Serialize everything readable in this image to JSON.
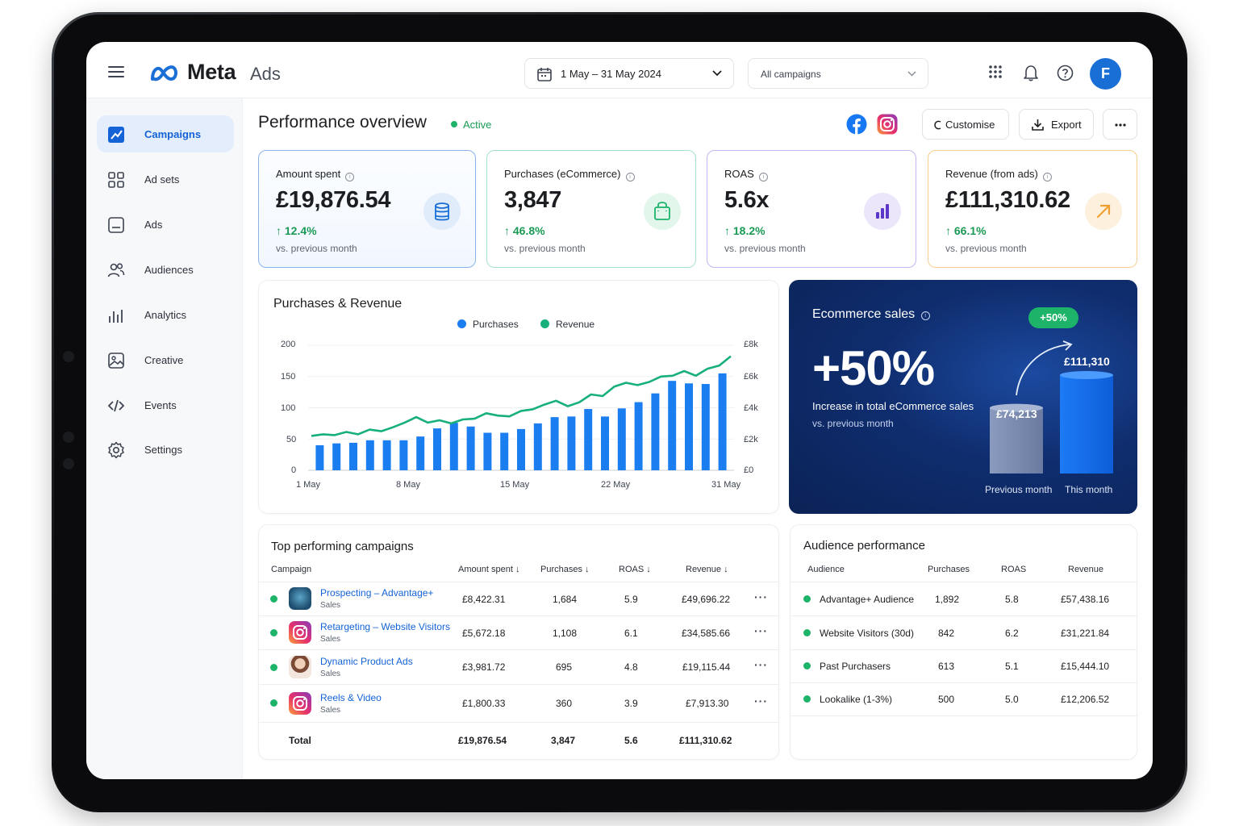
{
  "app": {
    "brand": "Meta",
    "brand_sub": "Ads"
  },
  "topbar": {
    "date_range": "1 May – 31 May 2024",
    "campaign_filter": "All campaigns",
    "avatar_initial": "F"
  },
  "sidebar": {
    "items": [
      {
        "label": "Campaigns",
        "icon": "campaigns-icon",
        "active": true
      },
      {
        "label": "Ad sets",
        "icon": "grid-icon"
      },
      {
        "label": "Ads",
        "icon": "ads-icon"
      },
      {
        "label": "Audiences",
        "icon": "people-icon"
      },
      {
        "label": "Analytics",
        "icon": "bar-chart-icon"
      },
      {
        "label": "Creative",
        "icon": "image-icon"
      },
      {
        "label": "Events",
        "icon": "code-icon"
      },
      {
        "label": "Settings",
        "icon": "gear-icon"
      }
    ]
  },
  "header": {
    "title": "Performance overview",
    "status": "Active",
    "customise_label": "Customise",
    "export_label": "Export"
  },
  "kpis": [
    {
      "label": "Amount spent",
      "value": "£19,876.54",
      "delta": "12.4%",
      "sub": "vs. previous month",
      "color": "#1a6fd6",
      "icon": "coins-icon"
    },
    {
      "label": "Purchases (eCommerce)",
      "value": "3,847",
      "delta": "46.8%",
      "sub": "vs. previous month",
      "color": "#1db46a",
      "icon": "shopping-bag-icon"
    },
    {
      "label": "ROAS",
      "value": "5.6x",
      "delta": "18.2%",
      "sub": "vs. previous month",
      "color": "#6a3fd6",
      "icon": "bar-chart-icon"
    },
    {
      "label": "Revenue (from ads)",
      "value": "£111,310.62",
      "delta": "66.1%",
      "sub": "vs. previous month",
      "color": "#f0a030",
      "icon": "arrow-up-right-icon"
    }
  ],
  "chart_data": {
    "type": "bar",
    "title": "Purchases & Revenue",
    "categories_ticks": [
      "1 May",
      "8 May",
      "15 May",
      "22 May",
      "31 May"
    ],
    "y_left_ticks": [
      "200",
      "150",
      "100",
      "50",
      "0"
    ],
    "y_right_ticks": [
      "£8k",
      "£6k",
      "£4k",
      "£2k",
      "£0"
    ],
    "ylim_left": [
      0,
      200
    ],
    "ylim_right": [
      0,
      8000
    ],
    "series": [
      {
        "name": "Purchases",
        "type": "bar",
        "color": "#1a7df0",
        "values": [
          40,
          43,
          44,
          48,
          48,
          48,
          54,
          67,
          76,
          70,
          60,
          60,
          66,
          75,
          85,
          86,
          98,
          86,
          99,
          109,
          123,
          143,
          139,
          138,
          155
        ]
      },
      {
        "name": "Revenue",
        "type": "line",
        "color": "#17b07a",
        "values": [
          2200,
          2300,
          2250,
          2450,
          2300,
          2600,
          2500,
          2750,
          3050,
          3400,
          3050,
          3200,
          3000,
          3250,
          3300,
          3650,
          3500,
          3450,
          3800,
          3900,
          4200,
          4450,
          4100,
          4350,
          4850,
          4750,
          5350,
          5600,
          5450,
          5650,
          6000,
          6050,
          6350,
          6050,
          6500,
          6700,
          7300
        ]
      }
    ]
  },
  "ecommerce": {
    "title": "Ecommerce sales",
    "pill": "+50%",
    "big": "+50%",
    "sub1": "Increase in total eCommerce sales",
    "sub2": "vs. previous month",
    "prev_value": "£74,213",
    "this_value": "£111,310",
    "prev_label": "Previous month",
    "this_label": "This month",
    "prev_amount": 74213,
    "this_amount": 111310
  },
  "campaigns": {
    "title": "Top performing campaigns",
    "headers": [
      "Campaign",
      "Amount spent",
      "Purchases",
      "ROAS",
      "Revenue"
    ],
    "rows": [
      {
        "name": "Prospecting – Advantage+",
        "sub": "Sales",
        "spent": "£8,422.31",
        "purchases": "1,684",
        "roas": "5.9",
        "revenue": "£49,696.22",
        "thumb": "meta-thumb"
      },
      {
        "name": "Retargeting – Website Visitors",
        "sub": "Sales",
        "spent": "£5,672.18",
        "purchases": "1,108",
        "roas": "6.1",
        "revenue": "£34,585.66",
        "thumb": "instagram-thumb"
      },
      {
        "name": "Dynamic Product Ads",
        "sub": "Sales",
        "spent": "£3,981.72",
        "purchases": "695",
        "roas": "4.8",
        "revenue": "£19,115.44",
        "thumb": "person-thumb"
      },
      {
        "name": "Reels & Video",
        "sub": "Sales",
        "spent": "£1,800.33",
        "purchases": "360",
        "roas": "3.9",
        "revenue": "£7,913.30",
        "thumb": "instagram-thumb"
      }
    ],
    "total": {
      "label": "Total",
      "spent": "£19,876.54",
      "purchases": "3,847",
      "roas": "5.6",
      "revenue": "£111,310.62"
    }
  },
  "audiences": {
    "title": "Audience performance",
    "headers": [
      "Audience",
      "Purchases",
      "ROAS",
      "Revenue"
    ],
    "rows": [
      {
        "name": "Advantage+ Audience",
        "purchases": "1,892",
        "roas": "5.8",
        "revenue": "£57,438.16"
      },
      {
        "name": "Website Visitors (30d)",
        "purchases": "842",
        "roas": "6.2",
        "revenue": "£31,221.84"
      },
      {
        "name": "Past Purchasers",
        "purchases": "613",
        "roas": "5.1",
        "revenue": "£15,444.10"
      },
      {
        "name": "Lookalike (1-3%)",
        "purchases": "500",
        "roas": "5.0",
        "revenue": "£12,206.52"
      }
    ]
  }
}
